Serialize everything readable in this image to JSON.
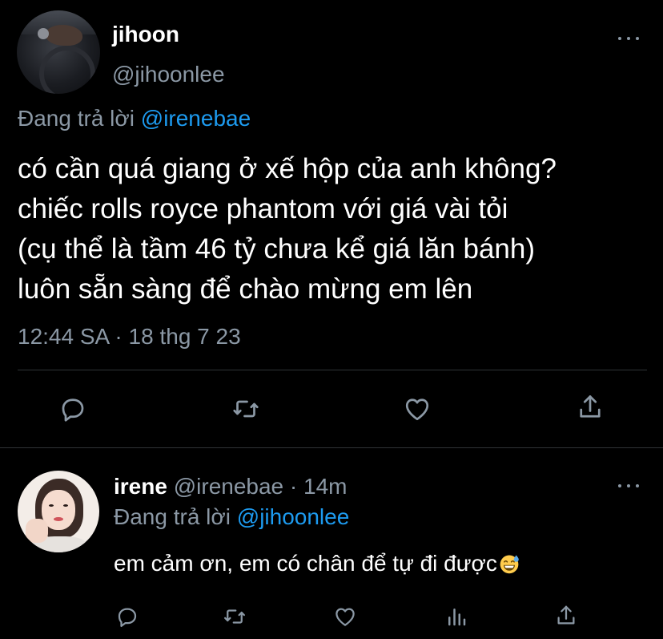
{
  "main_tweet": {
    "display_name": "jihoon",
    "handle": "@jihoonlee",
    "replying_to_prefix": "Đang trả lời",
    "replying_to_handle": "@irenebae",
    "text_lines": [
      "có cần quá giang ở xế hộp của anh không?",
      "chiếc rolls royce phantom với giá vài tỏi",
      "(cụ thể là tầm 46 tỷ chưa kể giá lăn bánh)",
      "luôn sẵn sàng để chào mừng em lên"
    ],
    "timestamp": "12:44 SA · 18 thg 7 23",
    "actions": [
      "reply-icon",
      "retweet-icon",
      "like-icon",
      "share-icon"
    ]
  },
  "reply_tweet": {
    "display_name": "irene",
    "handle_and_time": "@irenebae · 14m",
    "replying_to_prefix": "Đang trả lời",
    "replying_to_handle": "@jihoonlee",
    "text": "em cảm ơn, em có chân để tự đi được",
    "emoji": "grinning-face-with-sweat-emoji",
    "actions": [
      "reply-icon",
      "retweet-icon",
      "like-icon",
      "analytics-icon",
      "share-icon"
    ]
  },
  "colors": {
    "background": "#000000",
    "primary_text": "#ffffff",
    "secondary_text": "#8b98a5",
    "link": "#1d9bf0",
    "divider": "#2f3336"
  }
}
